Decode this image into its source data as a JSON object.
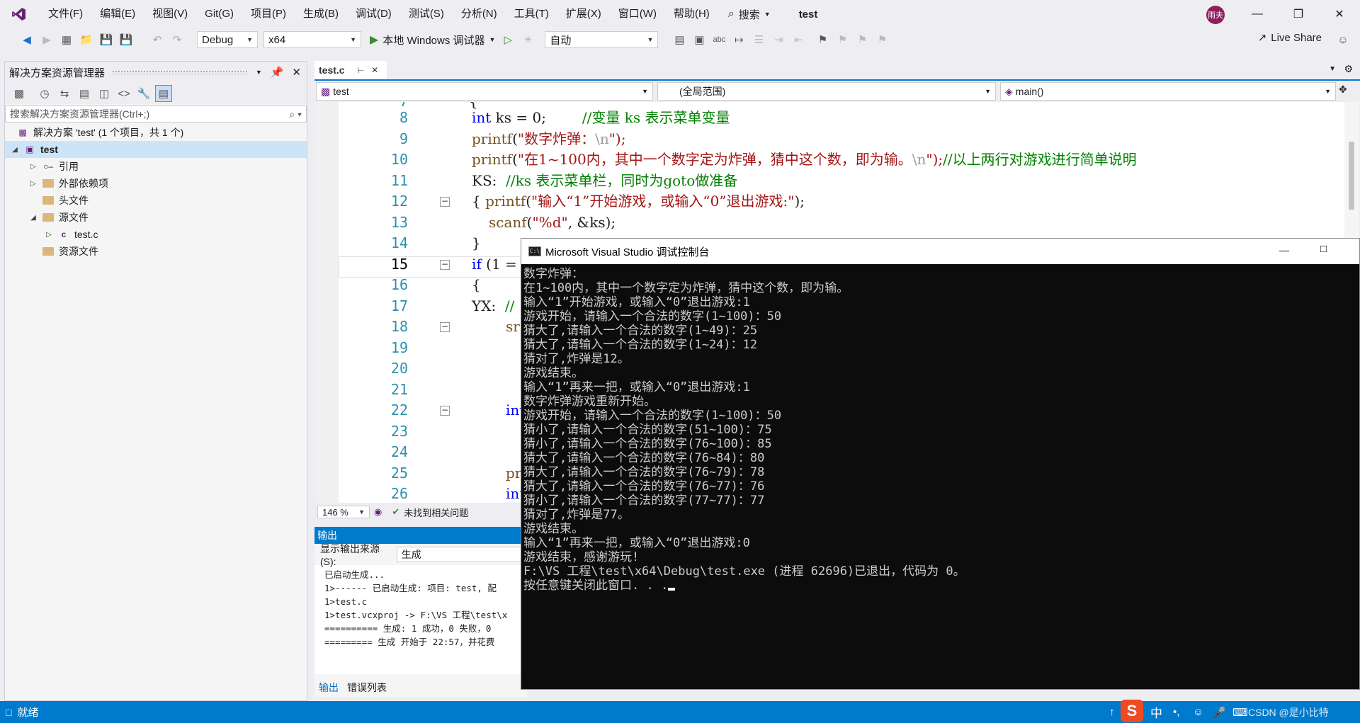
{
  "menu": {
    "items": [
      "文件(F)",
      "编辑(E)",
      "视图(V)",
      "Git(G)",
      "项目(P)",
      "生成(B)",
      "调试(D)",
      "测试(S)",
      "分析(N)",
      "工具(T)",
      "扩展(X)",
      "窗口(W)",
      "帮助(H)"
    ],
    "search_label": "搜索",
    "project_title": "test",
    "avatar_text": "雨夫"
  },
  "toolbar": {
    "config": "Debug",
    "platform": "x64",
    "run_label": "本地 Windows 调试器",
    "auto": "自动",
    "live_share": "Live Share"
  },
  "solution_explorer": {
    "title": "解决方案资源管理器",
    "search_placeholder": "搜索解决方案资源管理器(Ctrl+;)",
    "solution_label": "解决方案 'test' (1 个项目，共 1 个)",
    "project": "test",
    "nodes": [
      "引用",
      "外部依赖项",
      "头文件",
      "源文件",
      "test.c",
      "资源文件"
    ]
  },
  "editor": {
    "tab": "test.c",
    "nav_project": "test",
    "nav_scope": "(全局范围)",
    "nav_member": "main()",
    "zoom": "146 %",
    "issues": "未找到相关问题",
    "line_numbers": [
      "7",
      "8",
      "9",
      "10",
      "11",
      "12",
      "13",
      "14",
      "15",
      "16",
      "17",
      "18",
      "19",
      "20",
      "21",
      "22",
      "23",
      "24",
      "25",
      "26"
    ],
    "current_line": "15",
    "lines": {
      "l7": "{",
      "l8_kw": "int",
      "l8_code": " ks = 0;        ",
      "l8_cm": "//变量 ks 表示菜单变量",
      "l9_fn": "printf",
      "l9_a": "(",
      "l9_str": "\"数字炸弹：",
      "l9_esc": "\\n",
      "l9_b": "\");",
      "l10_fn": "printf",
      "l10_a": "(",
      "l10_str": "\"在1~100内，其中一个数字定为炸弹，猜中这个数，即为输。",
      "l10_esc": "\\n",
      "l10_b": "\");",
      "l10_cm": "//以上两行对游戏进行简单说明",
      "l11_code": "KS:  ",
      "l11_cm": "//ks 表示菜单栏，同时为goto做准备",
      "l12_a": "{ ",
      "l12_fn": "printf",
      "l12_b": "(",
      "l12_str": "\"输入“1”开始游戏，或输入“0”退出游戏:\"",
      "l12_c": ");",
      "l13_fn": "scanf",
      "l13_a": "(",
      "l13_str": "\"%d\"",
      "l13_b": ", &ks);",
      "l14": "}",
      "l15_kw": "if",
      "l15_code": " (1 =",
      "l16": "{",
      "l17_code": "YX:  ",
      "l17_cm": "//",
      "l18_fn": "sra",
      "l22_kw": "int",
      "l25_fn": "pri",
      "l26_kw": "int"
    }
  },
  "output": {
    "title": "输出",
    "source_label": "显示输出来源(S):",
    "source_value": "生成",
    "lines": [
      "已启动生成...",
      "1>------ 已启动生成: 项目: test, 配",
      "1>test.c",
      "1>test.vcxproj -> F:\\VS 工程\\test\\x",
      "========== 生成: 1 成功，0 失败，0",
      "========= 生成 开始于 22:57，并花费"
    ],
    "tab_output": "输出",
    "tab_errors": "错误列表"
  },
  "status": {
    "ready": "就绪",
    "ime": "中",
    "watermark": "CSDN @是小比特"
  },
  "console": {
    "title": "Microsoft Visual Studio 调试控制台",
    "lines": [
      "数字炸弹：",
      "在1~100内，其中一个数字定为炸弹，猜中这个数，即为输。",
      "输入“1”开始游戏，或输入“0”退出游戏:1",
      "游戏开始，请输入一个合法的数字(1~100)：50",
      "猜大了,请输入一个合法的数字(1~49)：25",
      "猜大了,请输入一个合法的数字(1~24)：12",
      "猜对了,炸弹是12。",
      "游戏结束。",
      "输入“1”再来一把，或输入“0”退出游戏:1",
      "数字炸弹游戏重新开始。",
      "游戏开始，请输入一个合法的数字(1~100)：50",
      "猜小了,请输入一个合法的数字(51~100)：75",
      "猜小了,请输入一个合法的数字(76~100)：85",
      "猜大了,请输入一个合法的数字(76~84)：80",
      "猜大了,请输入一个合法的数字(76~79)：78",
      "猜大了,请输入一个合法的数字(76~77)：76",
      "猜小了,请输入一个合法的数字(77~77)：77",
      "猜对了,炸弹是77。",
      "游戏结束。",
      "输入“1”再来一把，或输入“0”退出游戏:0",
      "游戏结束，感谢游玩!",
      "F:\\VS 工程\\test\\x64\\Debug\\test.exe (进程 62696)已退出，代码为 0。",
      "按任意键关闭此窗口. . ."
    ]
  }
}
